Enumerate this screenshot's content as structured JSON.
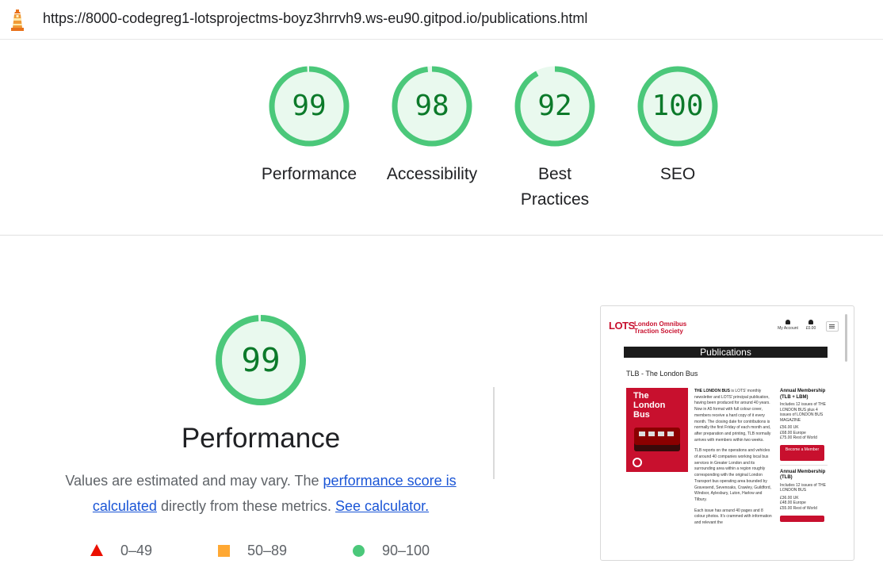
{
  "address_bar": {
    "url": "https://8000-codegreg1-lotsprojectms-boyz3hrrvh9.ws-eu90.gitpod.io/publications.html"
  },
  "colors": {
    "pass": "#0c7a2a",
    "pass_ring": "#4bc87a",
    "pass_bg": "#e9f9ee",
    "fail": "#eb0f00",
    "average": "#ffa833",
    "link": "#1a55d6"
  },
  "categories": [
    {
      "score": 99,
      "label": "Performance"
    },
    {
      "score": 98,
      "label": "Accessibility"
    },
    {
      "score": 92,
      "label": "Best Practices"
    },
    {
      "score": 100,
      "label": "SEO"
    }
  ],
  "performance": {
    "score": 99,
    "title": "Performance",
    "desc_prefix": "Values are estimated and may vary. The ",
    "link_score": "performance score is calculated",
    "desc_middle": " directly from these metrics. ",
    "link_calc": "See calculator."
  },
  "legend": [
    {
      "icon": "fail-triangle-icon",
      "range": "0–49"
    },
    {
      "icon": "average-square-icon",
      "range": "50–89"
    },
    {
      "icon": "pass-circle-icon",
      "range": "90–100"
    }
  ],
  "screenshot": {
    "logo": "LOTS",
    "brand_line1": "London Omnibus",
    "brand_line2": "Traction Society",
    "account_label": "My Account",
    "bag_total": "£0.00",
    "page_title": "Publications",
    "section_title": "TLB - The London Bus",
    "cover_title_1": "The",
    "cover_title_2": "London",
    "cover_title_3": "Bus",
    "body_bold": "THE LONDON BUS",
    "body_1": " is LOTS' monthly newsletter and LOTS' principal publication, having been produced for around 40 years. Now in A5 format with full colour cover, members receive a hard copy of it every month. The closing date for contributions is normally the first Friday of each month and, after preparation and printing, TLB normally arrives with members within two weeks.",
    "body_2": "TLB reports on the operations and vehicles of around 40 companies working local bus services in Greater London and its surrounding area within a region roughly corresponding with the original London Transport bus operating area bounded by Gravesend, Sevenoaks, Crawley, Guildford, Windsor, Aylesbury, Luton, Harlow and Tilbury.",
    "body_3": "Each issue has around 40 pages and 8 colour photos. It's crammed with information and relevant the",
    "plan1_title": "Annual Membership (TLB + LBM)",
    "plan1_desc": "Includes 12 issues of THE LONDON BUS plus 4 issues of LONDON BUS MAGAZINE",
    "plan1_p1": "£56.00 UK",
    "plan1_p2": "£68.00 Europe",
    "plan1_p3": "£75.00 Rest of World",
    "plan_button": "Become a Member",
    "plan2_title": "Annual Membership (TLB)",
    "plan2_desc": "Includes 12 issues of THE LONDON BUS",
    "plan2_p1": "£36.00 UK",
    "plan2_p2": "£48.00 Europe",
    "plan2_p3": "£55.00 Rest of World"
  }
}
